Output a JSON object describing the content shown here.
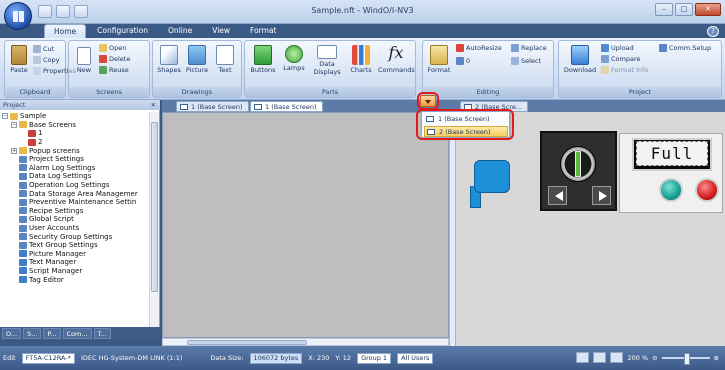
{
  "window": {
    "title": "Sample.nft - WindO/I-NV3",
    "controls": [
      "–",
      "□",
      "✕"
    ]
  },
  "ribbon_tabs": [
    "Home",
    "Configuration",
    "Online",
    "View",
    "Format"
  ],
  "ribbon": {
    "clipboard": {
      "label": "Clipboard",
      "paste": "Paste",
      "cut": "Cut",
      "copy": "Copy",
      "properties": "Properties"
    },
    "screens": {
      "label": "Screens",
      "new": "New",
      "open": "Open",
      "delete": "Delete",
      "reuse": "Reuse"
    },
    "drawings": {
      "label": "Drawings",
      "shapes": "Shapes",
      "picture": "Picture",
      "text": "Text"
    },
    "parts": {
      "label": "Parts",
      "buttons": "Buttons",
      "lamps": "Lamps",
      "data_displays": "Data Displays",
      "charts": "Charts",
      "commands": "Commands"
    },
    "editing": {
      "label": "Editing",
      "autoresize": "AutoResize",
      "replace": "Replace",
      "select": "Select",
      "format": "Format"
    },
    "project": {
      "label": "Project",
      "download": "Download",
      "upload": "Upload",
      "compare": "Compare",
      "comm_setup": "Comm.Setup",
      "format_info": "Format Info"
    }
  },
  "panel": {
    "title": "Project",
    "close": "✕",
    "tree": [
      {
        "label": "Sample",
        "level": 0,
        "toggle": "−",
        "color": "#e8b84a"
      },
      {
        "label": "Base Screens",
        "level": 1,
        "toggle": "−",
        "color": "#e8b84a"
      },
      {
        "label": "1",
        "level": 2,
        "toggle": "",
        "color": "#d23b3b"
      },
      {
        "label": "2",
        "level": 2,
        "toggle": "",
        "color": "#d23b3b"
      },
      {
        "label": "Popup screens",
        "level": 1,
        "toggle": "+",
        "color": "#e8b84a"
      },
      {
        "label": "Project Settings",
        "level": 1,
        "toggle": "",
        "color": "#5a86c4"
      },
      {
        "label": "Alarm Log Settings",
        "level": 1,
        "toggle": "",
        "color": "#5a86c4"
      },
      {
        "label": "Data Log Settings",
        "level": 1,
        "toggle": "",
        "color": "#5a86c4"
      },
      {
        "label": "Operation Log Settings",
        "level": 1,
        "toggle": "",
        "color": "#5a86c4"
      },
      {
        "label": "Data Storage Area Managemer",
        "level": 1,
        "toggle": "",
        "color": "#5a86c4"
      },
      {
        "label": "Preventive Maintenance Settin",
        "level": 1,
        "toggle": "",
        "color": "#5a86c4"
      },
      {
        "label": "Recipe Settings",
        "level": 1,
        "toggle": "",
        "color": "#5a86c4"
      },
      {
        "label": "Global Script",
        "level": 1,
        "toggle": "",
        "color": "#5a86c4"
      },
      {
        "label": "User Accounts",
        "level": 1,
        "toggle": "",
        "color": "#5a86c4"
      },
      {
        "label": "Security Group Settings",
        "level": 1,
        "toggle": "",
        "color": "#5a86c4"
      },
      {
        "label": "Text Group Settings",
        "level": 1,
        "toggle": "",
        "color": "#5a86c4"
      },
      {
        "label": "Picture Manager",
        "level": 1,
        "toggle": "",
        "color": "#3f7fc9"
      },
      {
        "label": "Text Manager",
        "level": 1,
        "toggle": "",
        "color": "#3f7fc9"
      },
      {
        "label": "Script Manager",
        "level": 1,
        "toggle": "",
        "color": "#3f7fc9"
      },
      {
        "label": "Tag Editor",
        "level": 1,
        "toggle": "",
        "color": "#3f7fc9"
      }
    ],
    "tabs": [
      "O...",
      "S...",
      "P...",
      "Com...",
      "T..."
    ]
  },
  "doc_tabs": [
    {
      "label": "1 (Base Screen)",
      "active": false
    },
    {
      "label": "1 (Base Screen)",
      "active": true
    },
    {
      "label": "2 (Base Scre...",
      "active": false
    }
  ],
  "screen_menu": [
    {
      "label": "1 (Base Screen)",
      "selected": false
    },
    {
      "label": "2 (Base Screen)",
      "selected": true
    }
  ],
  "hmi": {
    "message_display": "Full"
  },
  "status": {
    "mode": "Edit",
    "model": "FT5A-C12RA-*",
    "driver": "IDEC HG-System-DM LINK (1:1)",
    "data_size_label": "Data Size:",
    "data_size_value": "106072 bytes",
    "x_coord": "X: 230",
    "y_coord": "Y: 12",
    "group": "Group 1",
    "users": "All Users",
    "zoom": "200 %"
  },
  "colors": {
    "highlight": "#e21b1b",
    "accent": "#3c5a88"
  }
}
